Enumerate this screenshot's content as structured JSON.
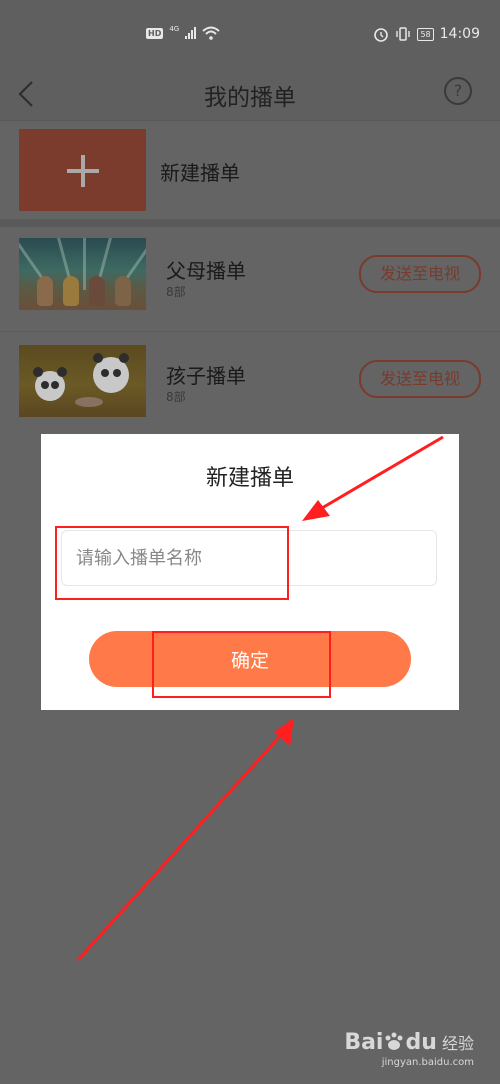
{
  "status_bar": {
    "hd": "HD",
    "network": "4G",
    "battery": "58",
    "time": "14:09"
  },
  "navbar": {
    "title": "我的播单",
    "help": "?"
  },
  "new_playlist": {
    "label": "新建播单"
  },
  "playlists": [
    {
      "name": "父母播单",
      "count": "8部",
      "send_label": "发送至电视"
    },
    {
      "name": "孩子播单",
      "count": "8部",
      "send_label": "发送至电视"
    }
  ],
  "dialog": {
    "title": "新建播单",
    "input_placeholder": "请输入播单名称",
    "confirm_label": "确定"
  },
  "watermark": {
    "logo": "Bai",
    "logo_du": "du",
    "cn": "经验",
    "url": "jingyan.baidu.com"
  },
  "colors": {
    "accent": "#ff7a48",
    "annotation": "#ff1f1f",
    "overlay": "#646464"
  }
}
